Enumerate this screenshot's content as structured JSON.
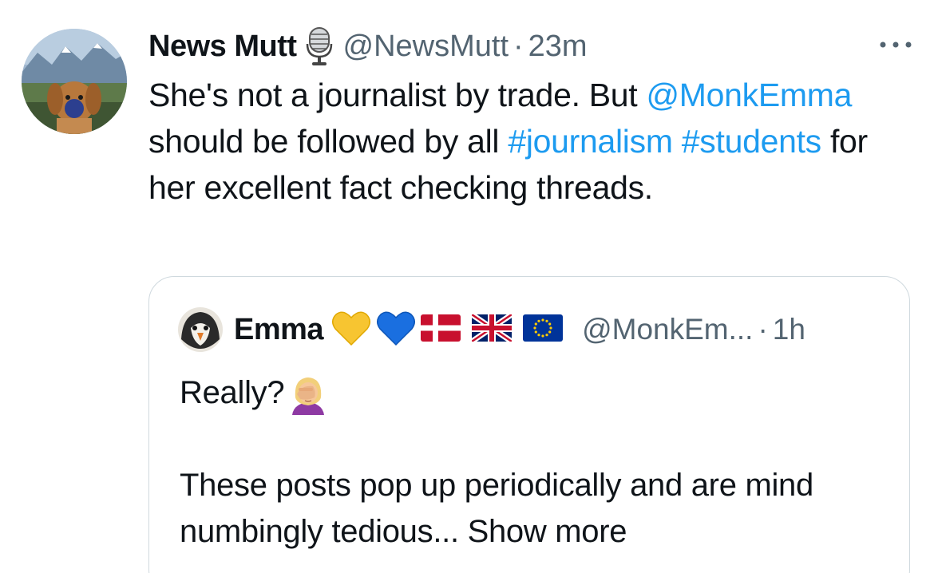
{
  "post": {
    "author_name": "News Mutt",
    "author_handle": "@NewsMutt",
    "separator": "·",
    "time": "23m",
    "author_icon": "microphone-icon",
    "more_icon": "more-options-icon",
    "body": {
      "text_1": "She's not a journalist by trade. But ",
      "mention": "@MonkEmma",
      "text_2": " should be followed by all ",
      "hashtag_1": "#journalism",
      "hashtag_2": "#students",
      "text_3": " for her excellent fact checking threads."
    }
  },
  "quoted_post": {
    "author_name": "Emma",
    "author_handle": "@MonkEm...",
    "separator": "·",
    "time": "1h",
    "name_emojis": [
      "yellow-heart-icon",
      "blue-heart-icon",
      "denmark-flag-icon",
      "uk-flag-icon",
      "eu-flag-icon"
    ],
    "line_1": "Really?",
    "line_1_emoji": "facepalm-icon",
    "line_2": "",
    "line_3": "These posts pop up periodically and are mind numbingly tedious...",
    "show_more": "Show more"
  },
  "colors": {
    "link": "#1d9bf0",
    "secondary_text": "#536471",
    "border": "#cfd9de",
    "text": "#0f1419"
  }
}
